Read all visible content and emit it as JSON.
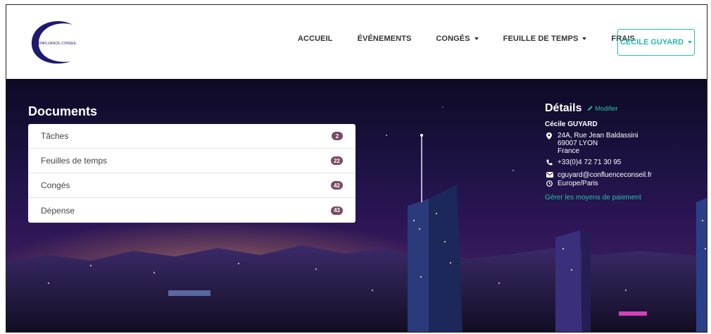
{
  "brand": {
    "logo_text": "CONFLUENCE CONSEIL"
  },
  "nav": {
    "items": [
      {
        "label": "ACCUEIL",
        "dropdown": false
      },
      {
        "label": "ÉVÉNEMENTS",
        "dropdown": false
      },
      {
        "label": "CONGÉS",
        "dropdown": true
      },
      {
        "label": "FEUILLE DE TEMPS",
        "dropdown": true
      },
      {
        "label": "FRAIS",
        "dropdown": false
      }
    ],
    "user_label": "CÉCILE GUYARD"
  },
  "documents": {
    "title": "Documents",
    "items": [
      {
        "label": "Tâches",
        "count": "2"
      },
      {
        "label": "Feuilles de temps",
        "count": "22"
      },
      {
        "label": "Congés",
        "count": "42"
      },
      {
        "label": "Dépense",
        "count": "43"
      }
    ]
  },
  "details": {
    "title": "Détails",
    "modify_label": "Modifier",
    "name": "Cécile GUYARD",
    "address_line1": "24A, Rue Jean Baldassini",
    "address_line2": "69007 LYON",
    "address_line3": "France",
    "phone": "+33(0)4 72 71 30 95",
    "email": "cguyard@confluenceconseil.fr",
    "timezone": "Europe/Paris",
    "payment_link": "Gérer les moyens de paiement"
  },
  "colors": {
    "accent": "#25b9b3",
    "link": "#25c4a4",
    "badge": "#7b4b66",
    "logo": "#1e1a6e"
  }
}
